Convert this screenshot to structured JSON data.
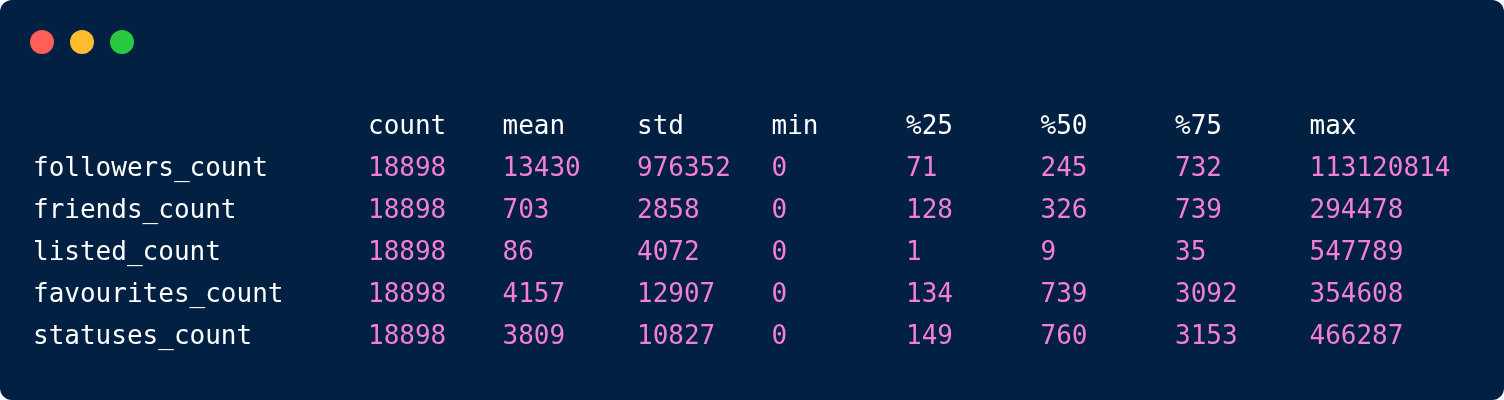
{
  "table": {
    "columns": [
      "count",
      "mean",
      "std",
      "min",
      "%25",
      "%50",
      "%75",
      "max"
    ],
    "rows": [
      {
        "label": "followers_count",
        "values": [
          "18898",
          "13430",
          "976352",
          "0",
          "71",
          "245",
          "732",
          "113120814"
        ]
      },
      {
        "label": "friends_count",
        "values": [
          "18898",
          "703",
          "2858",
          "0",
          "128",
          "326",
          "739",
          "294478"
        ]
      },
      {
        "label": "listed_count",
        "values": [
          "18898",
          "86",
          "4072",
          "0",
          "1",
          "9",
          "35",
          "547789"
        ]
      },
      {
        "label": "favourites_count",
        "values": [
          "18898",
          "4157",
          "12907",
          "0",
          "134",
          "739",
          "3092",
          "354608"
        ]
      },
      {
        "label": "statuses_count",
        "values": [
          "18898",
          "3809",
          "10827",
          "0",
          "149",
          "760",
          "3153",
          "466287"
        ]
      }
    ]
  }
}
